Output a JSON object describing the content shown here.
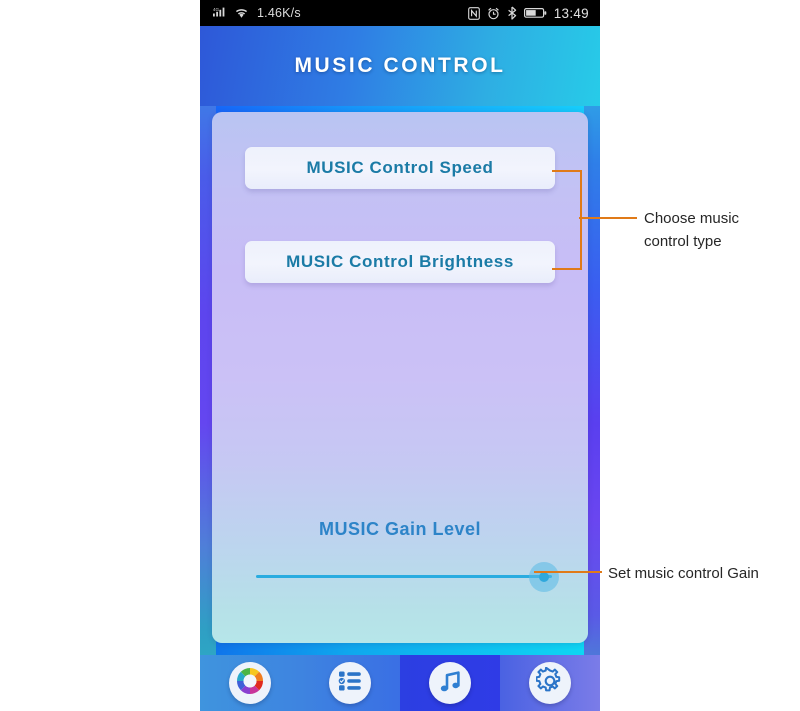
{
  "statusbar": {
    "network_speed": "1.46K/s",
    "time": "13:49",
    "icons_left": [
      "signal-4g-icon",
      "wifi-icon"
    ],
    "icons_right": [
      "nfc-icon",
      "alarm-icon",
      "bluetooth-icon",
      "battery-icon"
    ]
  },
  "header": {
    "title": "MUSIC CONTROL"
  },
  "card": {
    "buttons": [
      {
        "label": "MUSIC Control Speed"
      },
      {
        "label": "MUSIC Control Brightness"
      }
    ],
    "gain": {
      "label": "MUSIC Gain Level",
      "slider_value_percent": 92
    }
  },
  "nav": {
    "items": [
      {
        "icon": "color-wheel-icon",
        "active": false
      },
      {
        "icon": "list-icon",
        "active": false
      },
      {
        "icon": "music-note-icon",
        "active": true
      },
      {
        "icon": "gear-icon",
        "active": false
      }
    ]
  },
  "annotations": [
    {
      "line1": "Choose music",
      "line2": "control type"
    },
    {
      "line1": "Set music control Gain",
      "line2": ""
    }
  ],
  "colors": {
    "accent_orange": "#e07a18",
    "button_text": "#1b7ba6",
    "header_text": "#ffffff",
    "gain_label": "#2d84c8",
    "slider_track": "#29ace0"
  }
}
